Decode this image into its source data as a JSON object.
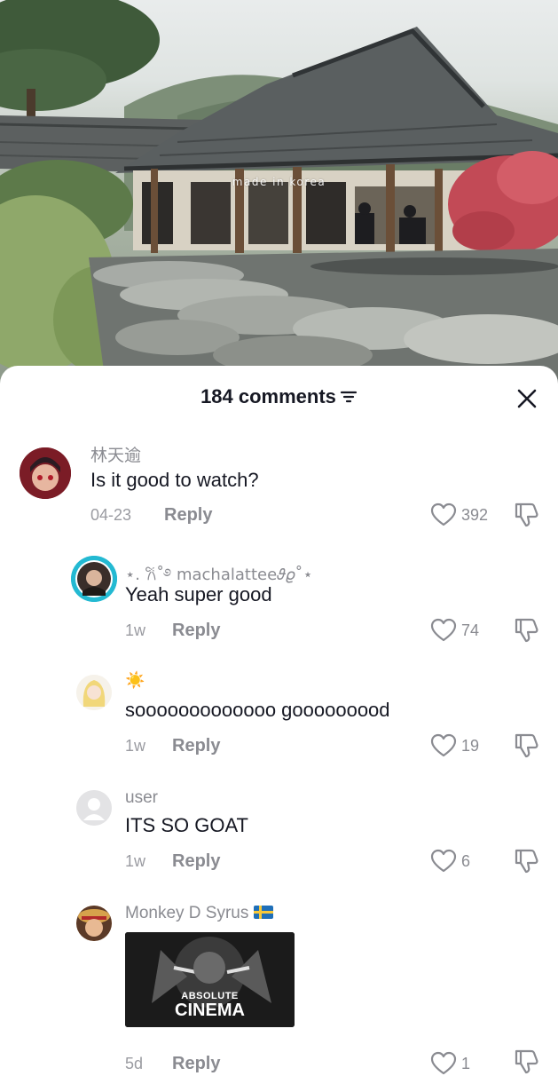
{
  "video": {
    "watermark": "made in korea"
  },
  "sheet": {
    "title": "184 comments"
  },
  "comments": [
    {
      "username": "林天逾",
      "text": "Is it good to watch?",
      "date": "04-23",
      "reply_label": "Reply",
      "likes": "392"
    },
    {
      "username": "⋆. 𐙚˚࿔ machalattee𝜗𝜚˚⋆",
      "text": "Yeah super good",
      "date": "1w",
      "reply_label": "Reply",
      "likes": "74"
    },
    {
      "username": "☀️",
      "text": "sooooooooooooo gooooooood",
      "date": "1w",
      "reply_label": "Reply",
      "likes": "19"
    },
    {
      "username": "user",
      "text": "ITS SO GOAT",
      "date": "1w",
      "reply_label": "Reply",
      "likes": "6"
    },
    {
      "username": "Monkey D Syrus",
      "sticker_text_top": "ABSOLUTE",
      "sticker_text_bottom": "CINEMA",
      "date": "5d",
      "reply_label": "Reply",
      "likes": "1"
    }
  ]
}
